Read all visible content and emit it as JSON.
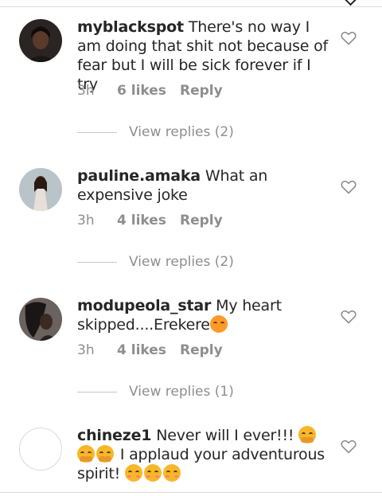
{
  "comments": [
    {
      "username": "myblackspot",
      "text": "There's no way I am doing that shit not because of fear but I will be sick forever if I try",
      "time": "3h",
      "likes": "6 likes",
      "reply": "Reply",
      "view_replies": "View replies (2)"
    },
    {
      "username": "pauline.amaka",
      "text": "What an expensive joke",
      "time": "3h",
      "likes": "4 likes",
      "reply": "Reply",
      "view_replies": "View replies (2)"
    },
    {
      "username": "modupeola_star",
      "text": "My heart skipped....Erekere",
      "time": "3h",
      "likes": "4 likes",
      "reply": "Reply",
      "view_replies": "View replies (1)"
    },
    {
      "username": "chineze1",
      "text_a": "Never will I ever!!!",
      "text_b": "I applaud your adventurous spirit!"
    }
  ],
  "icons": {
    "heart": "heart-outline-icon",
    "top": "chevron-down-icon"
  },
  "colors": {
    "text": "#262626",
    "secondary": "#8e8e8e",
    "divider": "#dbdbdb"
  }
}
